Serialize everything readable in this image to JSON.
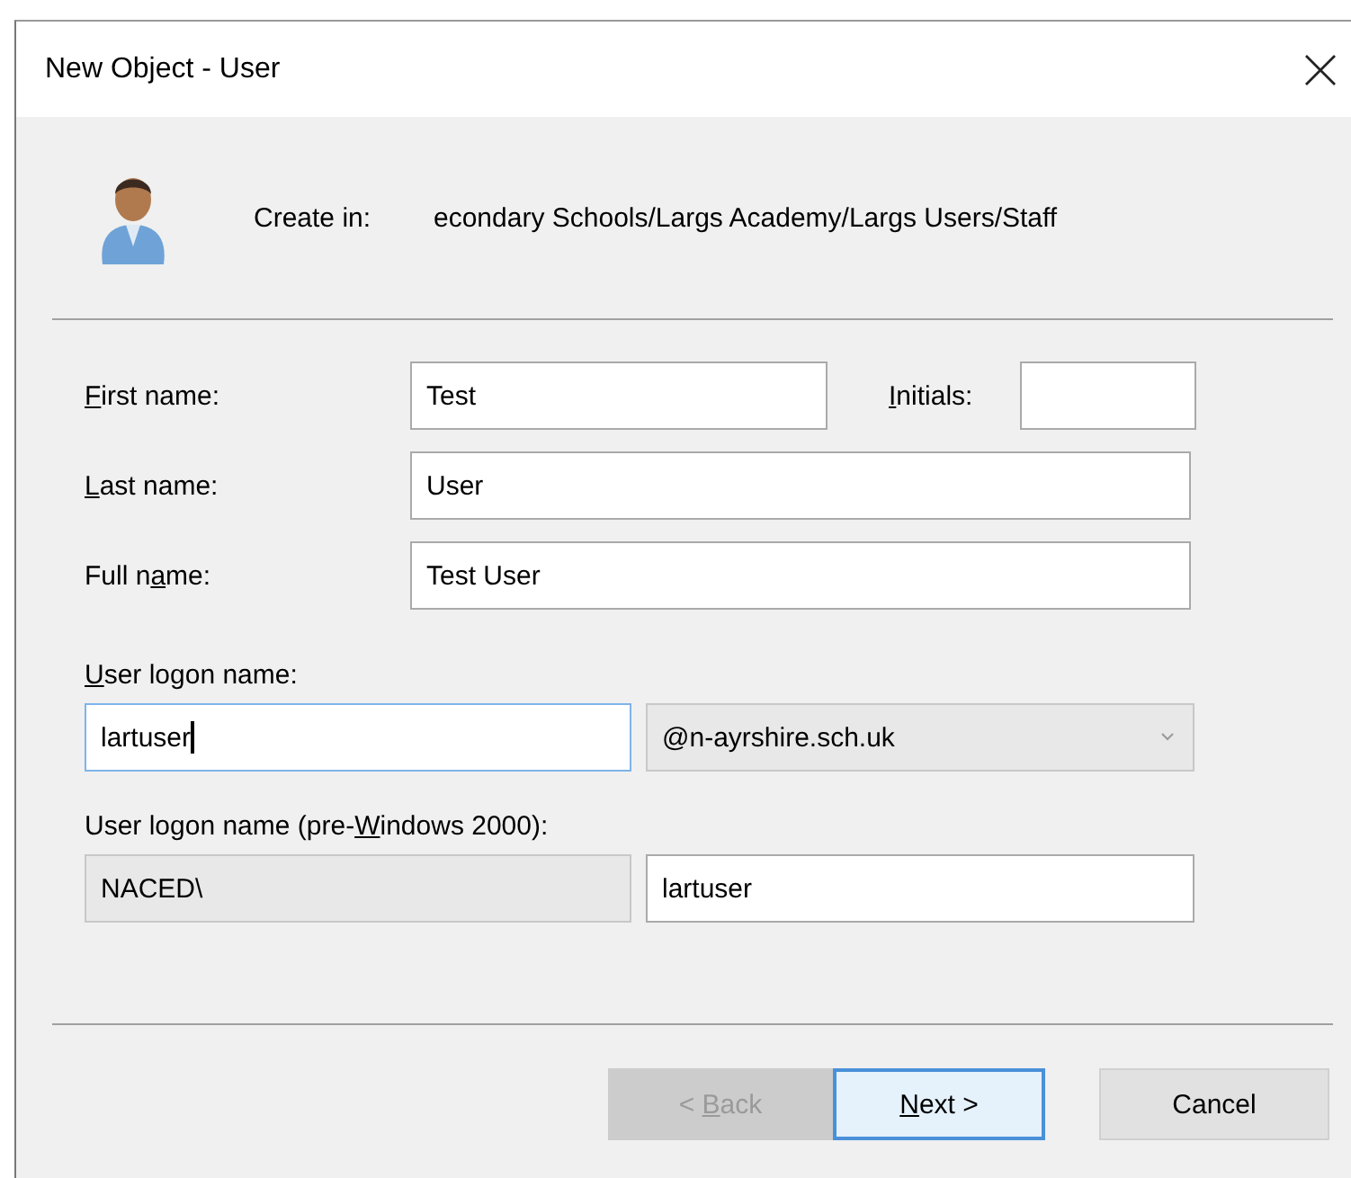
{
  "window": {
    "title": "New Object - User"
  },
  "create_in": {
    "label": "Create in:",
    "path": "econdary Schools/Largs Academy/Largs Users/Staff"
  },
  "first_name": {
    "label": [
      {
        "text": "F",
        "underline": true
      },
      {
        "text": "irst name:",
        "underline": false
      }
    ],
    "value": "Test"
  },
  "initials": {
    "label": [
      {
        "text": "I",
        "underline": true
      },
      {
        "text": "nitials:",
        "underline": false
      }
    ]
  },
  "last_name": {
    "label": [
      {
        "text": "L",
        "underline": true
      },
      {
        "text": "ast name:",
        "underline": false
      }
    ],
    "value": "User"
  },
  "full_name": {
    "label": [
      {
        "text": "Full n",
        "underline": false
      },
      {
        "text": "a",
        "underline": true
      },
      {
        "text": "me:",
        "underline": false
      }
    ],
    "value": "Test User"
  },
  "logon_name": {
    "label": [
      {
        "text": "U",
        "underline": true
      },
      {
        "text": "ser logon name:",
        "underline": false
      }
    ],
    "value": "lartuser",
    "focused": true
  },
  "domain": {
    "value": "@n-ayrshire.sch.uk",
    "disabled": true
  },
  "pre_windows_2000": {
    "label": [
      {
        "text": "User logon name (pre-",
        "underline": false
      },
      {
        "text": "W",
        "underline": true
      },
      {
        "text": "indows 2000):",
        "underline": false
      }
    ],
    "domain": "NACED\\",
    "value": "lartuser"
  },
  "buttons": [
    {
      "label": [
        {
          "text": "< ",
          "underline": false
        },
        {
          "text": "B",
          "underline": true
        },
        {
          "text": "ack",
          "underline": false
        }
      ],
      "disabled": true,
      "focused": false
    },
    {
      "label": [
        {
          "text": "N",
          "underline": true
        },
        {
          "text": "ext >",
          "underline": false
        }
      ],
      "disabled": false,
      "focused": true
    },
    {
      "label": [
        {
          "text": "Cancel",
          "underline": false
        }
      ],
      "disabled": false,
      "focused": false
    }
  ]
}
